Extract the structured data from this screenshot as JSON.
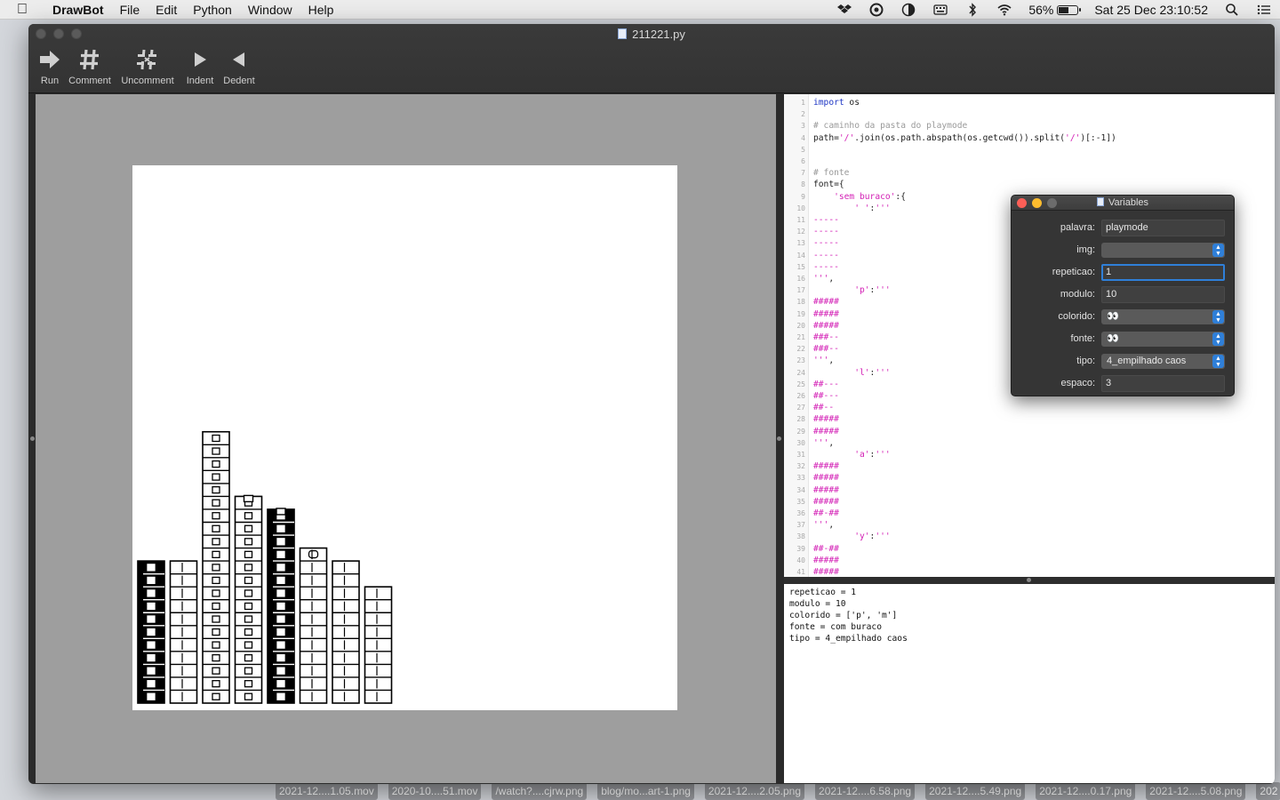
{
  "menubar": {
    "app_name": "DrawBot",
    "items": [
      "File",
      "Edit",
      "Python",
      "Window",
      "Help"
    ],
    "battery": "56%",
    "battery_level": 0.56,
    "datetime": "Sat 25 Dec  23:10:52"
  },
  "window": {
    "title": "211221.py",
    "toolbar": [
      {
        "label": "Run",
        "icon": "run-arrow-icon"
      },
      {
        "label": "Comment",
        "icon": "hash-icon"
      },
      {
        "label": "Uncomment",
        "icon": "hash-broken-icon"
      },
      {
        "label": "Indent",
        "icon": "triangle-right-icon"
      },
      {
        "label": "Dedent",
        "icon": "triangle-left-icon"
      }
    ]
  },
  "editor": {
    "lines": [
      {
        "n": "1",
        "parts": [
          [
            "kw",
            "import"
          ],
          [
            "pn",
            " os"
          ]
        ]
      },
      {
        "n": "2",
        "parts": []
      },
      {
        "n": "3",
        "parts": [
          [
            "cm",
            "# caminho da pasta do playmode"
          ]
        ]
      },
      {
        "n": "4",
        "parts": [
          [
            "pn",
            "path="
          ],
          [
            "st",
            "'/'"
          ],
          [
            "pn",
            ".join(os.path.abspath(os.getcwd()).split("
          ],
          [
            "st",
            "'/'"
          ],
          [
            "pn",
            ")[:-1])"
          ]
        ]
      },
      {
        "n": "5",
        "parts": []
      },
      {
        "n": "6",
        "parts": []
      },
      {
        "n": "7",
        "parts": [
          [
            "cm",
            "# fonte"
          ]
        ]
      },
      {
        "n": "8",
        "parts": [
          [
            "pn",
            "font={"
          ]
        ]
      },
      {
        "n": "9",
        "parts": [
          [
            "pn",
            "    "
          ],
          [
            "st",
            "'sem buraco'"
          ],
          [
            "pn",
            ":{"
          ]
        ]
      },
      {
        "n": "10",
        "parts": [
          [
            "pn",
            "        "
          ],
          [
            "st",
            "' '"
          ],
          [
            "pn",
            ":"
          ],
          [
            "st",
            "'''"
          ]
        ]
      },
      {
        "n": "11",
        "parts": [
          [
            "st",
            "-----"
          ]
        ]
      },
      {
        "n": "12",
        "parts": [
          [
            "st",
            "-----"
          ]
        ]
      },
      {
        "n": "13",
        "parts": [
          [
            "st",
            "-----"
          ]
        ]
      },
      {
        "n": "14",
        "parts": [
          [
            "st",
            "-----"
          ]
        ]
      },
      {
        "n": "15",
        "parts": [
          [
            "st",
            "-----"
          ]
        ]
      },
      {
        "n": "16",
        "parts": [
          [
            "st",
            "'''"
          ],
          [
            "pn",
            ","
          ]
        ]
      },
      {
        "n": "17",
        "parts": [
          [
            "pn",
            "        "
          ],
          [
            "st",
            "'p'"
          ],
          [
            "pn",
            ":"
          ],
          [
            "st",
            "'''"
          ]
        ]
      },
      {
        "n": "18",
        "parts": [
          [
            "st",
            "#####"
          ]
        ]
      },
      {
        "n": "19",
        "parts": [
          [
            "st",
            "#####"
          ]
        ]
      },
      {
        "n": "20",
        "parts": [
          [
            "st",
            "#####"
          ]
        ]
      },
      {
        "n": "21",
        "parts": [
          [
            "st",
            "###--"
          ]
        ]
      },
      {
        "n": "22",
        "parts": [
          [
            "st",
            "###--"
          ]
        ]
      },
      {
        "n": "23",
        "parts": [
          [
            "st",
            "'''"
          ],
          [
            "pn",
            ","
          ]
        ]
      },
      {
        "n": "24",
        "parts": [
          [
            "pn",
            "        "
          ],
          [
            "st",
            "'l'"
          ],
          [
            "pn",
            ":"
          ],
          [
            "st",
            "'''"
          ]
        ]
      },
      {
        "n": "25",
        "parts": [
          [
            "st",
            "##---"
          ]
        ]
      },
      {
        "n": "26",
        "parts": [
          [
            "st",
            "##---"
          ]
        ]
      },
      {
        "n": "27",
        "parts": [
          [
            "st",
            "##--"
          ]
        ]
      },
      {
        "n": "28",
        "parts": [
          [
            "st",
            "#####"
          ]
        ]
      },
      {
        "n": "29",
        "parts": [
          [
            "st",
            "#####"
          ]
        ]
      },
      {
        "n": "30",
        "parts": [
          [
            "st",
            "'''"
          ],
          [
            "pn",
            ","
          ]
        ]
      },
      {
        "n": "31",
        "parts": [
          [
            "pn",
            "        "
          ],
          [
            "st",
            "'a'"
          ],
          [
            "pn",
            ":"
          ],
          [
            "st",
            "'''"
          ]
        ]
      },
      {
        "n": "32",
        "parts": [
          [
            "st",
            "#####"
          ]
        ]
      },
      {
        "n": "33",
        "parts": [
          [
            "st",
            "#####"
          ]
        ]
      },
      {
        "n": "34",
        "parts": [
          [
            "st",
            "#####"
          ]
        ]
      },
      {
        "n": "35",
        "parts": [
          [
            "st",
            "#####"
          ]
        ]
      },
      {
        "n": "36",
        "parts": [
          [
            "st",
            "##-##"
          ]
        ]
      },
      {
        "n": "37",
        "parts": [
          [
            "st",
            "'''"
          ],
          [
            "pn",
            ","
          ]
        ]
      },
      {
        "n": "38",
        "parts": [
          [
            "pn",
            "        "
          ],
          [
            "st",
            "'y'"
          ],
          [
            "pn",
            ":"
          ],
          [
            "st",
            "'''"
          ]
        ]
      },
      {
        "n": "39",
        "parts": [
          [
            "st",
            "##-##"
          ]
        ]
      },
      {
        "n": "40",
        "parts": [
          [
            "st",
            "#####"
          ]
        ]
      },
      {
        "n": "41",
        "parts": [
          [
            "st",
            "#####"
          ]
        ]
      }
    ]
  },
  "output": {
    "lines": [
      "repeticao = 1",
      "modulo = 10",
      "colorido = ['p', 'm']",
      "fonte = com buraco",
      "tipo = 4_empilhado caos"
    ]
  },
  "variables": {
    "title": "Variables",
    "rows": [
      {
        "label": "palavra:",
        "kind": "text",
        "value": "playmode"
      },
      {
        "label": "img:",
        "kind": "popup",
        "value": ""
      },
      {
        "label": "repeticao:",
        "kind": "text-focused",
        "value": "1"
      },
      {
        "label": "modulo:",
        "kind": "text",
        "value": "10"
      },
      {
        "label": "colorido:",
        "kind": "popup",
        "value": "👀"
      },
      {
        "label": "fonte:",
        "kind": "popup",
        "value": "👀"
      },
      {
        "label": "tipo:",
        "kind": "popup",
        "value": "4_empilhado caos"
      },
      {
        "label": "espaco:",
        "kind": "text",
        "value": "3"
      }
    ]
  },
  "desktop_files": [
    "2021-12....1.05.mov",
    "2020-10....51.mov",
    "/watch?....cjrw.png",
    "blog/mo...art-1.png",
    "2021-12....2.05.png",
    "2021-12....6.58.png",
    "2021-12....5.49.png",
    "2021-12....0.17.png",
    "2021-12....5.08.png",
    "202"
  ],
  "artwork": {
    "columns": [
      {
        "cells": 11,
        "filled": true,
        "cap": "square"
      },
      {
        "cells": 11,
        "filled": false,
        "cap": "flat"
      },
      {
        "cells": 21,
        "filled": false,
        "cap": "square"
      },
      {
        "cells": 16,
        "filled": false,
        "cap": "notch"
      },
      {
        "cells": 15,
        "filled": true,
        "cap": "notch"
      },
      {
        "cells": 12,
        "filled": false,
        "cap": "arch"
      },
      {
        "cells": 11,
        "filled": false,
        "cap": "step"
      },
      {
        "cells": 9,
        "filled": false,
        "cap": "flat"
      }
    ]
  },
  "colors": {
    "window_bg": "#2b2b2b",
    "canvas_bg": "#9e9e9e",
    "keyword": "#1d35c4",
    "string": "#d31fb5",
    "comment": "#9a9a9a",
    "focus_ring": "#2f7fd8"
  }
}
